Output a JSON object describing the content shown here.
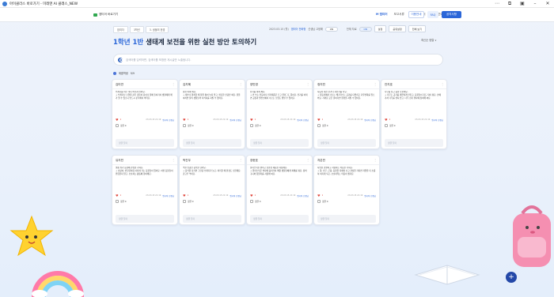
{
  "window": {
    "title": "아이클라스 바로가기 - 미래엔 AI 클래스_NEW",
    "controls": [
      "more",
      "puzzle",
      "box",
      "minimize",
      "close"
    ]
  },
  "nav": {
    "logo_label": "엠티어 바로가기",
    "links": [
      "M 엠티어",
      "보고서류",
      "화면 모니 터",
      "사업 안내"
    ],
    "guide_label": "이용안내",
    "faq_label": "FAQ",
    "notice_label": "공지사항"
  },
  "breadcrumb": [
    "참여자",
    "3학년",
    "3. 생물의 한경"
  ],
  "toolbar": {
    "label_1": "2023.03.15 (월)",
    "label_2": "엠티어 전화형",
    "label_3": "선생님 고정해",
    "toggle_1": "ON",
    "label_4": "전체 자료",
    "toggle_2": "ON",
    "btn_1": "설정",
    "btn_2": "공유설정",
    "btn_3": "전체 보기"
  },
  "page": {
    "class_label": "1학년 1반",
    "topic": "생태계 보전을 위한 실천 방안 토의하기",
    "sort_label": "최신순 정렬 ∨"
  },
  "search": {
    "placeholder": "검색어를 입력하면, 검색어를 포함한 게시글만 노출됩니다."
  },
  "participants": {
    "label": "제출학생",
    "count": "9/9"
  },
  "cards": [
    {
      "name": "김미연",
      "body": "쓰레기를 아무 데나 버리지 않아요.\n→ 쓰레기나 오염물 같은 것들이 흙이나 물에 들어가서 생물에게 해가 될 수 있으니 반드시 분리해서 버려요.",
      "likes": "1",
      "date": "23.03.15 21:19",
      "author": "엠티어 선생님",
      "comments": "댓글 0",
      "reply_placeholder": "댓글 달기"
    },
    {
      "name": "김지혜",
      "body": "물을 아껴 써요.\n→ 세수나 양치할 때 물을 틀어 놓지 않고, 필요한 만큼만 써요. 물을 아끼면 물속 생물들의 서식지를 지킬 수 있어요.",
      "likes": "1",
      "date": "23.03.15 21:19",
      "author": "엠티어 선생님",
      "comments": "댓글 0",
      "reply_placeholder": "댓글 달기"
    },
    {
      "name": "양민영",
      "body": "전기를 아껴 써요.\n→ 안 쓰는 전등이나 전자제품은 끄고 플러그도 뽑아요. 전기를 아끼면 공장과 발전소에서 나오는 오염도 줄일 수 있어요.",
      "likes": "1",
      "date": "23.03.15 21:19",
      "author": "엠티어 선생님",
      "comments": "댓글 0",
      "reply_placeholder": "댓글 달기"
    },
    {
      "name": "정지민",
      "body": "자동차 대신 걷거나 자전거를 타요.\n→ 자동차에서 나오는 배기가스는 공기를 더럽히고 기후변화를 일으켜요. 가까운 곳은 걸어가면 환경을 지킬 수 있어요.",
      "likes": "1",
      "date": "23.03.15 21:19",
      "author": "엠티어 선생님",
      "comments": "댓글 0",
      "reply_placeholder": "댓글 달기"
    },
    {
      "name": "안지호",
      "body": "나무를 심고 숲을 보호해요.\n→ 나무는 공기를 깨끗하게 만들고, 동물들이 집도 되어 줘요. 산에 가서 나무를 꺾지 않고, 나무 심기 행사에 참여해 봐요.",
      "likes": "1",
      "date": "23.03.15 21:19",
      "author": "엠티어 선생님",
      "comments": "댓글 0",
      "reply_placeholder": "댓글 달기"
    },
    {
      "name": "유지민",
      "body": "멸종 위기 동물에 관심을 가져요.\n→ 호랑이, 반달곰처럼 사라져 가는 동물들이 있어요. 어떤 동물들이 위험한지 알고, 보호하는 활동에 참여해요.",
      "likes": "1",
      "date": "23.03.15 21:19",
      "author": "엠티어 선생님",
      "comments": "댓글 0",
      "reply_placeholder": "댓글 달기"
    },
    {
      "name": "박진우",
      "body": "먹을 만큼만 음식을 덜어요.\n→ 음식물 남기면 그만큼 쓰레기가 늘고, 처리할 때 환경도 오염돼요. 골고루 먹어요.",
      "likes": "1",
      "date": "23.03.15 21:19",
      "author": "엠티어 선생님",
      "comments": "댓글 0",
      "reply_placeholder": "댓글 달기"
    },
    {
      "name": "장현호",
      "body": "플라스틱을 줄이고 친환경 제품을 사용해요.\n→ 플라스틱은 바다에 흘러가서 해양 생물들에게 피해를 줘요. 장바구니와 텀블러를 사용해 봐요.",
      "likes": "1",
      "date": "23.03.15 21:19",
      "author": "엠티어 선생님",
      "comments": "댓글 0",
      "reply_placeholder": "댓글 달기"
    },
    {
      "name": "차은빈",
      "body": "자연을 관찰하고 사랑하는 마음을 가져요.\n→ 꽃, 나무, 곤충, 동물을 자세히 보고 관심을 가지면 자연을 더 소중히 여기게 되고, 보호하려는 마음이 생겨요.",
      "likes": "1",
      "date": "23.03.15 21:19",
      "author": "엠티어 선생님",
      "comments": "댓글 0",
      "reply_placeholder": "댓글 달기"
    }
  ],
  "fab_label": "+",
  "colors": {
    "accent": "#2b66d8",
    "heart": "#e0483e",
    "fab": "#2448a8"
  }
}
